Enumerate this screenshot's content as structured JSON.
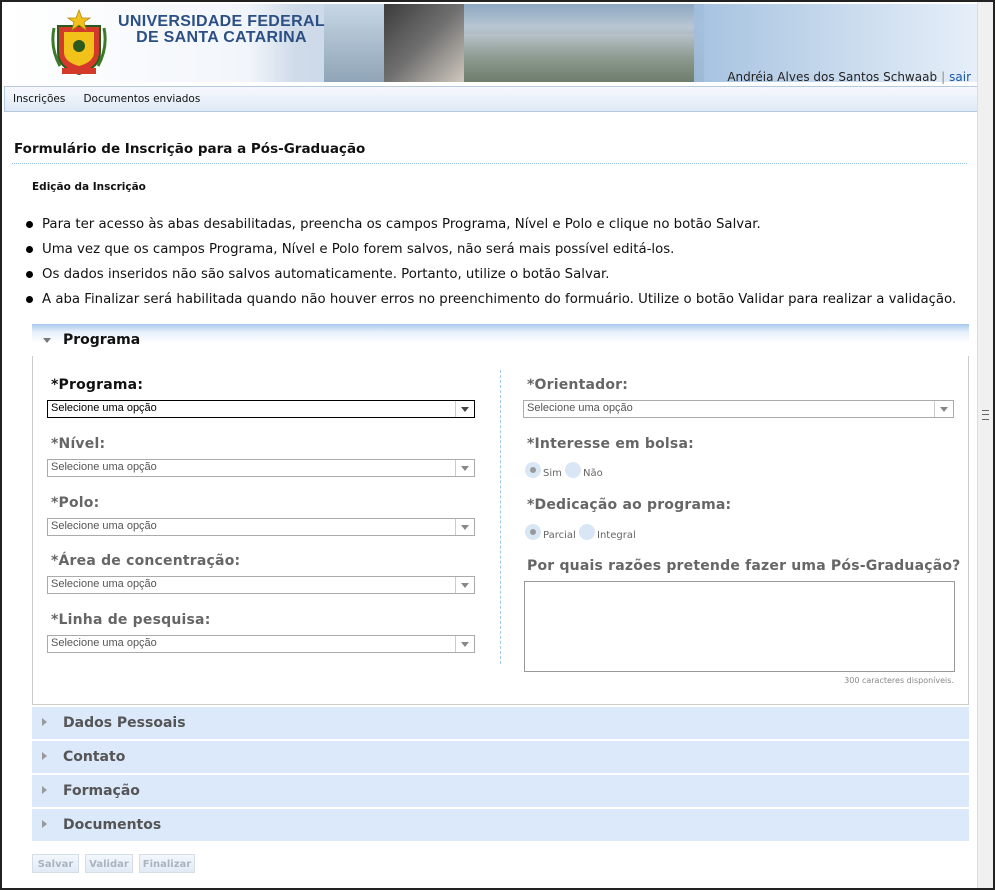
{
  "header": {
    "university_line1": "UNIVERSIDADE FEDERAL",
    "university_line2": "DE SANTA CATARINA",
    "user_name": "Andréia Alves dos Santos Schwaab",
    "separator": "|",
    "logout_label": "sair"
  },
  "menu": {
    "items": [
      {
        "label": "Inscrições"
      },
      {
        "label": "Documentos enviados"
      }
    ]
  },
  "page": {
    "title": "Formulário de Inscrição para a Pós-Graduação",
    "subtitle": "Edição da Inscrição",
    "notes": [
      "Para ter acesso às abas desabilitadas, preencha os campos Programa, Nível e Polo e clique no botão Salvar.",
      "Uma vez que os campos Programa, Nível e Polo forem salvos, não será mais possível editá-los.",
      "Os dados inseridos não são salvos automaticamente. Portanto, utilize o botão Salvar.",
      "A aba Finalizar será habilitada quando não houver erros no preenchimento do formuário. Utilize o botão Validar para realizar a validação."
    ]
  },
  "sections": {
    "programa": {
      "label": "Programa",
      "left_fields": [
        {
          "label": "*Programa:",
          "value": "Selecione uma opção"
        },
        {
          "label": "*Nível:",
          "value": "Selecione uma opção"
        },
        {
          "label": "*Polo:",
          "value": "Selecione uma opção"
        },
        {
          "label": "*Área de concentração:",
          "value": "Selecione uma opção"
        },
        {
          "label": "*Linha de pesquisa:",
          "value": "Selecione uma opção"
        }
      ],
      "orientador": {
        "label": "*Orientador:",
        "value": "Selecione uma opção"
      },
      "bolsa": {
        "label": "*Interesse em bolsa:",
        "options": [
          "Sim",
          "Não"
        ],
        "selected": "Sim"
      },
      "dedicacao": {
        "label": "*Dedicação ao programa:",
        "options": [
          "Parcial",
          "Integral"
        ],
        "selected": "Parcial"
      },
      "razoes": {
        "label": "Por quais razões pretende fazer uma Pós-Graduação?",
        "value": "",
        "counter": "300 caracteres disponíveis."
      }
    },
    "collapsed": [
      {
        "label": "Dados Pessoais"
      },
      {
        "label": "Contato"
      },
      {
        "label": "Formação"
      },
      {
        "label": "Documentos"
      }
    ]
  },
  "buttons": {
    "salvar": "Salvar",
    "validar": "Validar",
    "finalizar": "Finalizar"
  }
}
